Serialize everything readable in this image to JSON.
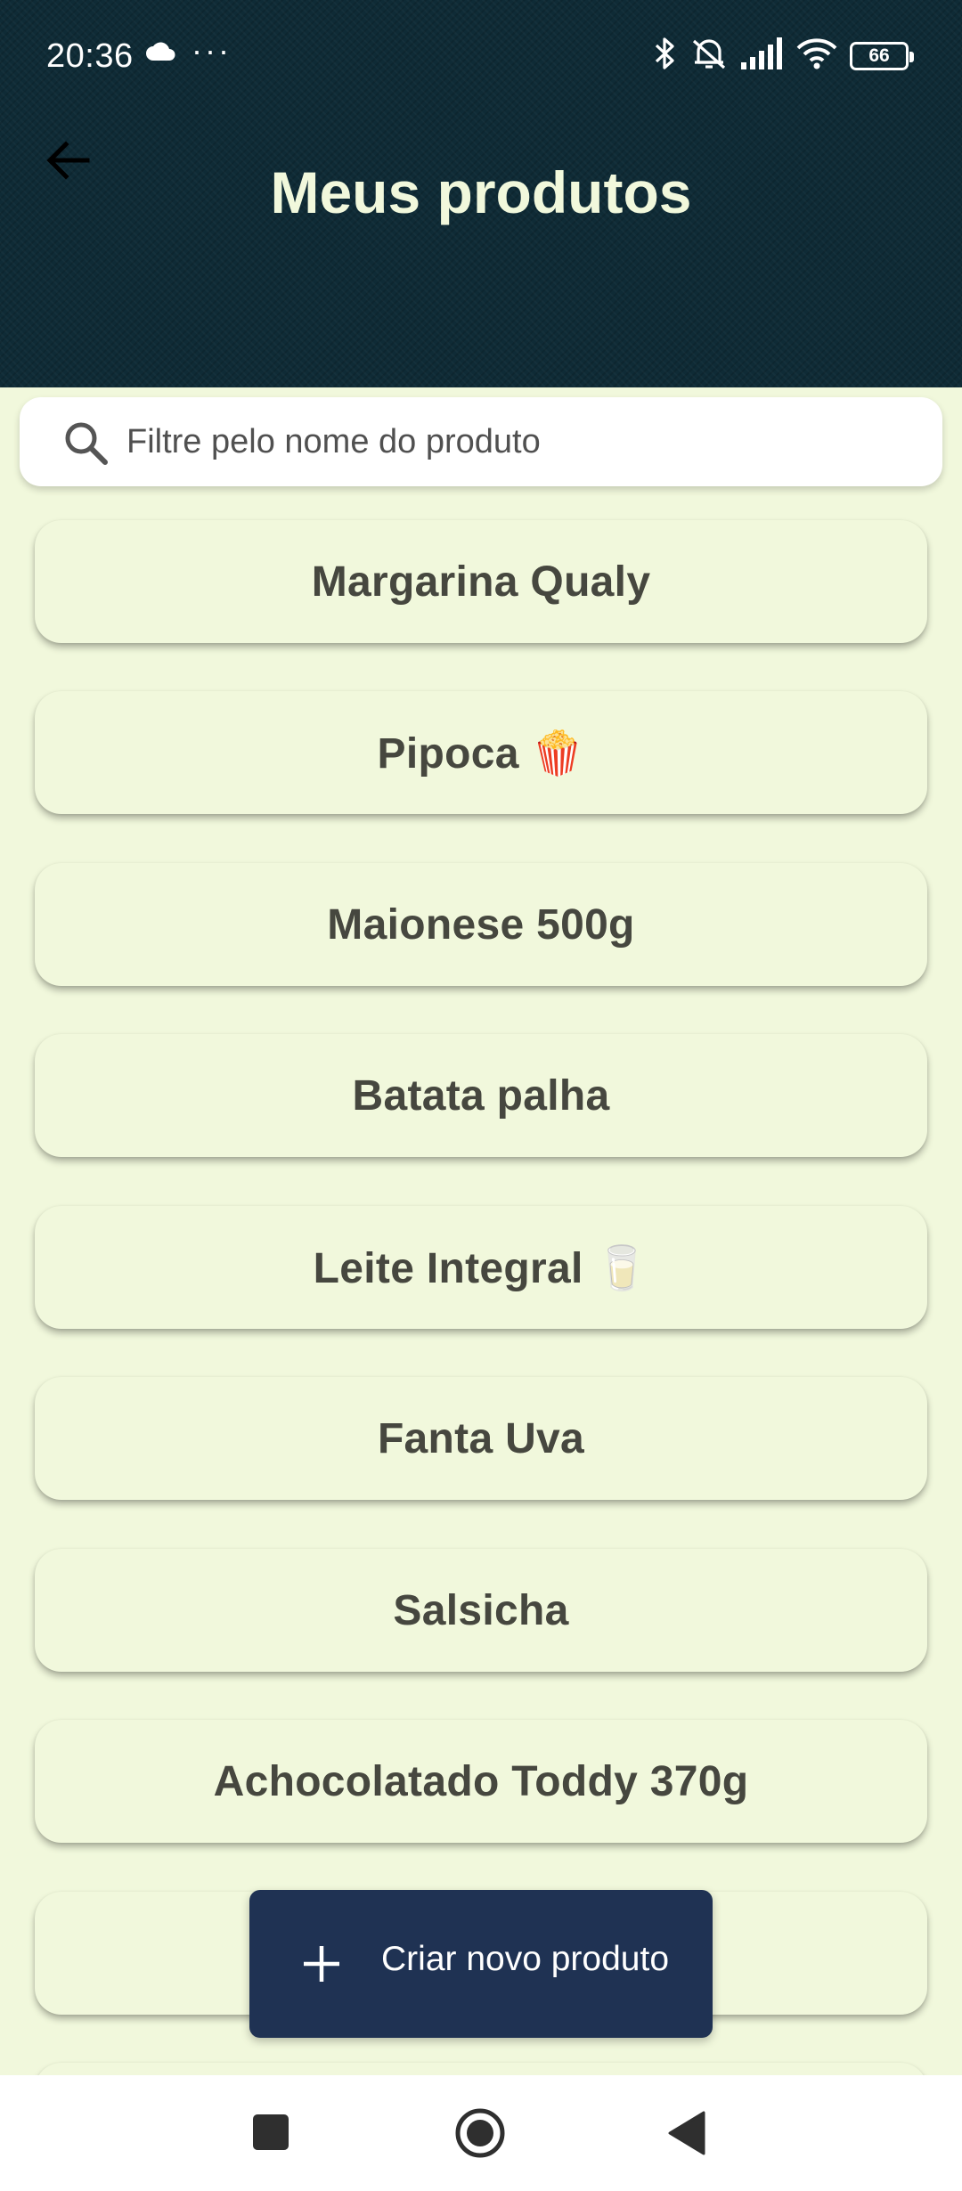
{
  "status_bar": {
    "time": "20:36",
    "dots": "···",
    "battery": "66"
  },
  "header": {
    "title": "Meus produtos"
  },
  "search": {
    "placeholder": "Filtre pelo nome do produto"
  },
  "products": [
    {
      "label": "Margarina Qualy"
    },
    {
      "label": "Pipoca 🍿"
    },
    {
      "label": "Maionese 500g"
    },
    {
      "label": "Batata palha"
    },
    {
      "label": "Leite Integral 🥛"
    },
    {
      "label": "Fanta Uva"
    },
    {
      "label": "Salsicha"
    },
    {
      "label": "Achocolatado Toddy 370g"
    },
    {
      "label": ""
    }
  ],
  "fab": {
    "label": "Criar novo produto"
  },
  "colors": {
    "header_bg": "#0f2b36",
    "page_bg": "#f1f8dc",
    "title": "#f1f8dc",
    "card_text": "#46473f",
    "fab_bg": "#1f3253"
  },
  "icons": {
    "back": "arrow-left-icon",
    "search": "search-icon",
    "add": "plus-icon",
    "nav_recent": "square-icon",
    "nav_home": "circle-icon",
    "nav_back": "triangle-icon"
  }
}
